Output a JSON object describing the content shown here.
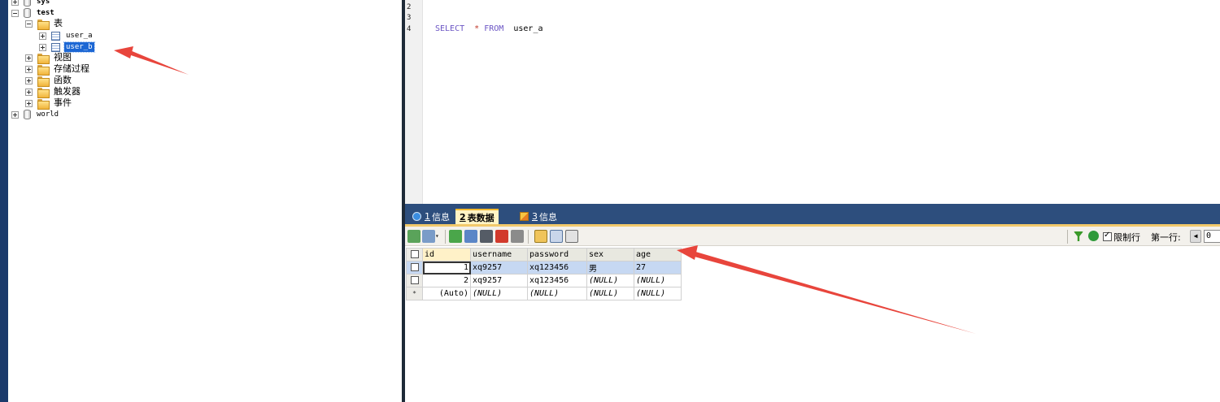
{
  "tree": {
    "items": [
      {
        "label": "sys",
        "kind": "db",
        "expanded": false
      },
      {
        "label": "test",
        "kind": "db",
        "expanded": true
      },
      {
        "label": "表",
        "kind": "folder",
        "expanded": true
      },
      {
        "label": "user_a",
        "kind": "table",
        "expanded": false
      },
      {
        "label": "user_b",
        "kind": "table",
        "expanded": false,
        "selected": true
      },
      {
        "label": "视图",
        "kind": "folder",
        "expanded": false
      },
      {
        "label": "存储过程",
        "kind": "folder",
        "expanded": false
      },
      {
        "label": "函数",
        "kind": "folder",
        "expanded": false
      },
      {
        "label": "触发器",
        "kind": "folder",
        "expanded": false
      },
      {
        "label": "事件",
        "kind": "folder",
        "expanded": false
      },
      {
        "label": "world",
        "kind": "db",
        "expanded": false
      }
    ]
  },
  "editor": {
    "line_numbers": [
      "2",
      "3",
      "4"
    ],
    "query": {
      "kw1": "SELECT",
      "star": "*",
      "kw2": "FROM",
      "table": "user_a"
    }
  },
  "results": {
    "tabs": [
      {
        "num": "1",
        "label": "信息",
        "icon": "info-icon"
      },
      {
        "num": "2",
        "label": "表数据",
        "icon": "grid-icon",
        "active": true
      },
      {
        "num": "3",
        "label": "信息",
        "icon": "warning-icon"
      }
    ],
    "toolbar": {
      "limit_label": "限制行",
      "limit_checked": true,
      "first_row_label": "第一行:",
      "first_row_value": "0"
    },
    "columns": [
      "id",
      "username",
      "password",
      "sex",
      "age"
    ],
    "rows": [
      {
        "id": "1",
        "username": "xq9257",
        "password": "xq123456",
        "sex": "男",
        "age": "27",
        "selected": true
      },
      {
        "id": "2",
        "username": "xq9257",
        "password": "xq123456",
        "sex": "(NULL)",
        "age": "(NULL)"
      },
      {
        "id": "(Auto)",
        "username": "(NULL)",
        "password": "(NULL)",
        "sex": "(NULL)",
        "age": "(NULL)",
        "new_row": true
      }
    ]
  },
  "colors": {
    "tabbar": "#2d4e7d",
    "selection": "#1c67d4",
    "annotation_arrow": "#e8453c",
    "keyword": "#6b55c4"
  }
}
